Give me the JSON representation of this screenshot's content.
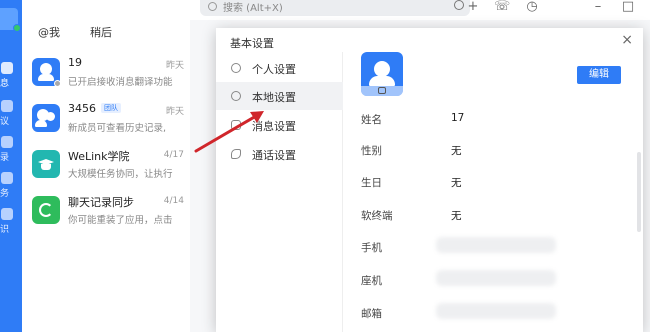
{
  "search": {
    "placeholder": "搜索 (Alt+X)"
  },
  "rail": {
    "items": [
      {
        "label": "息"
      },
      {
        "label": "议"
      },
      {
        "label": "录"
      },
      {
        "label": "务"
      },
      {
        "label": "识"
      }
    ]
  },
  "conversation_tabs": [
    {
      "label": "@我"
    },
    {
      "label": "稍后"
    }
  ],
  "conversations": [
    {
      "name": "19",
      "badge": "",
      "time": "昨天",
      "message": "已开启接收消息翻译功能",
      "avatar_color": "#2f7cf6"
    },
    {
      "name": "3456",
      "badge": "团队",
      "time": "昨天",
      "message": "新成员可查看历史记录,",
      "avatar_color": "#2f7cf6"
    },
    {
      "name": "WeLink学院",
      "badge": "",
      "time": "4/17",
      "message": "大规模任务协同，让执行",
      "avatar_color": "#22b7b0"
    },
    {
      "name": "聊天记录同步",
      "badge": "",
      "time": "4/14",
      "message": "你可能重装了应用，点击",
      "avatar_color": "#2ebc5c"
    }
  ],
  "dialog": {
    "title": "基本设置",
    "close_label": "×",
    "menu": [
      {
        "label": "个人设置"
      },
      {
        "label": "本地设置",
        "selected": true
      },
      {
        "label": "消息设置"
      },
      {
        "label": "通话设置"
      }
    ],
    "edit_label": "编辑",
    "fields": [
      {
        "key": "姓名",
        "value": "17"
      },
      {
        "key": "性别",
        "value": "无"
      },
      {
        "key": "生日",
        "value": "无"
      },
      {
        "key": "软终端",
        "value": "无"
      },
      {
        "key": "手机",
        "value": ""
      },
      {
        "key": "座机",
        "value": ""
      },
      {
        "key": "邮箱",
        "value": ""
      }
    ]
  },
  "colors": {
    "accent": "#2f7cf6",
    "annotation_arrow": "#d0262b"
  }
}
